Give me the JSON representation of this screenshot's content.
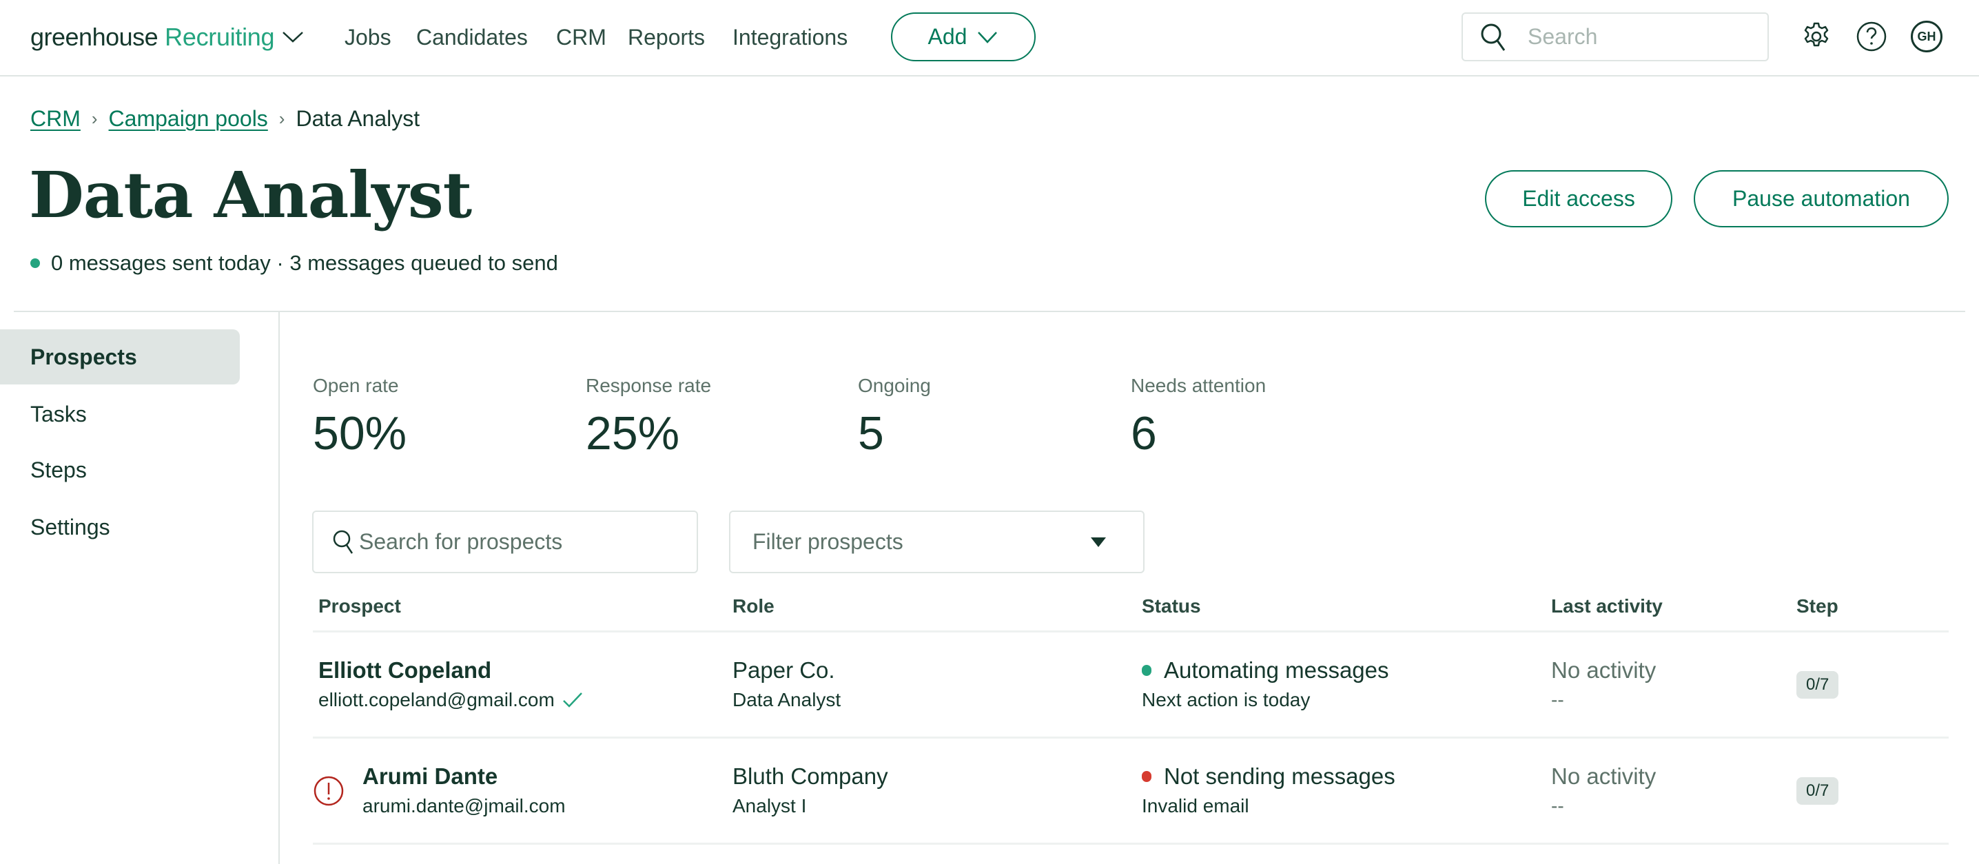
{
  "header": {
    "logo_primary": "greenhouse",
    "logo_secondary": "Recruiting",
    "nav": [
      "Jobs",
      "Candidates",
      "CRM",
      "Reports",
      "Integrations"
    ],
    "add_label": "Add",
    "search_placeholder": "Search",
    "avatar_initials": "GH",
    "icons": [
      "chevron-down-icon",
      "search-icon",
      "gear-icon",
      "help-icon"
    ]
  },
  "breadcrumb": {
    "items": [
      "CRM",
      "Campaign pools"
    ],
    "current": "Data Analyst"
  },
  "page": {
    "title": "Data Analyst",
    "status_text": "0 messages sent today · 3 messages queued to send",
    "status_color": "#24a47f",
    "actions": {
      "edit_access": "Edit access",
      "pause_automation": "Pause automation"
    }
  },
  "sidebar": {
    "items": [
      {
        "label": "Prospects",
        "active": true
      },
      {
        "label": "Tasks",
        "active": false
      },
      {
        "label": "Steps",
        "active": false
      },
      {
        "label": "Settings",
        "active": false
      }
    ]
  },
  "stats": [
    {
      "label": "Open rate",
      "value": "50%"
    },
    {
      "label": "Response rate",
      "value": "25%"
    },
    {
      "label": "Ongoing",
      "value": "5"
    },
    {
      "label": "Needs attention",
      "value": "6"
    }
  ],
  "filters": {
    "search_placeholder": "Search for prospects",
    "filter_placeholder": "Filter prospects"
  },
  "table": {
    "columns": [
      "Prospect",
      "Role",
      "Status",
      "Last activity",
      "Step"
    ],
    "rows": [
      {
        "name": "Elliott Copeland",
        "email": "elliott.copeland@gmail.com",
        "email_verified": true,
        "has_error": false,
        "company": "Paper Co.",
        "role": "Data Analyst",
        "status": "Automating messages",
        "status_color": "#24a47f",
        "status_detail": "Next action is today",
        "last_activity": "No activity",
        "last_activity_detail": "--",
        "step": "0/7"
      },
      {
        "name": "Arumi Dante",
        "email": "arumi.dante@jmail.com",
        "email_verified": false,
        "has_error": true,
        "company": "Bluth Company",
        "role": "Analyst I",
        "status": "Not sending messages",
        "status_color": "#d63b2f",
        "status_detail": "Invalid email",
        "last_activity": "No activity",
        "last_activity_detail": "--",
        "step": "0/7"
      }
    ]
  },
  "colors": {
    "brand_green": "#047a5a",
    "accent_green": "#24a47f",
    "text_dark": "#15372c",
    "muted": "#5d7269",
    "error_red": "#b3261e"
  }
}
